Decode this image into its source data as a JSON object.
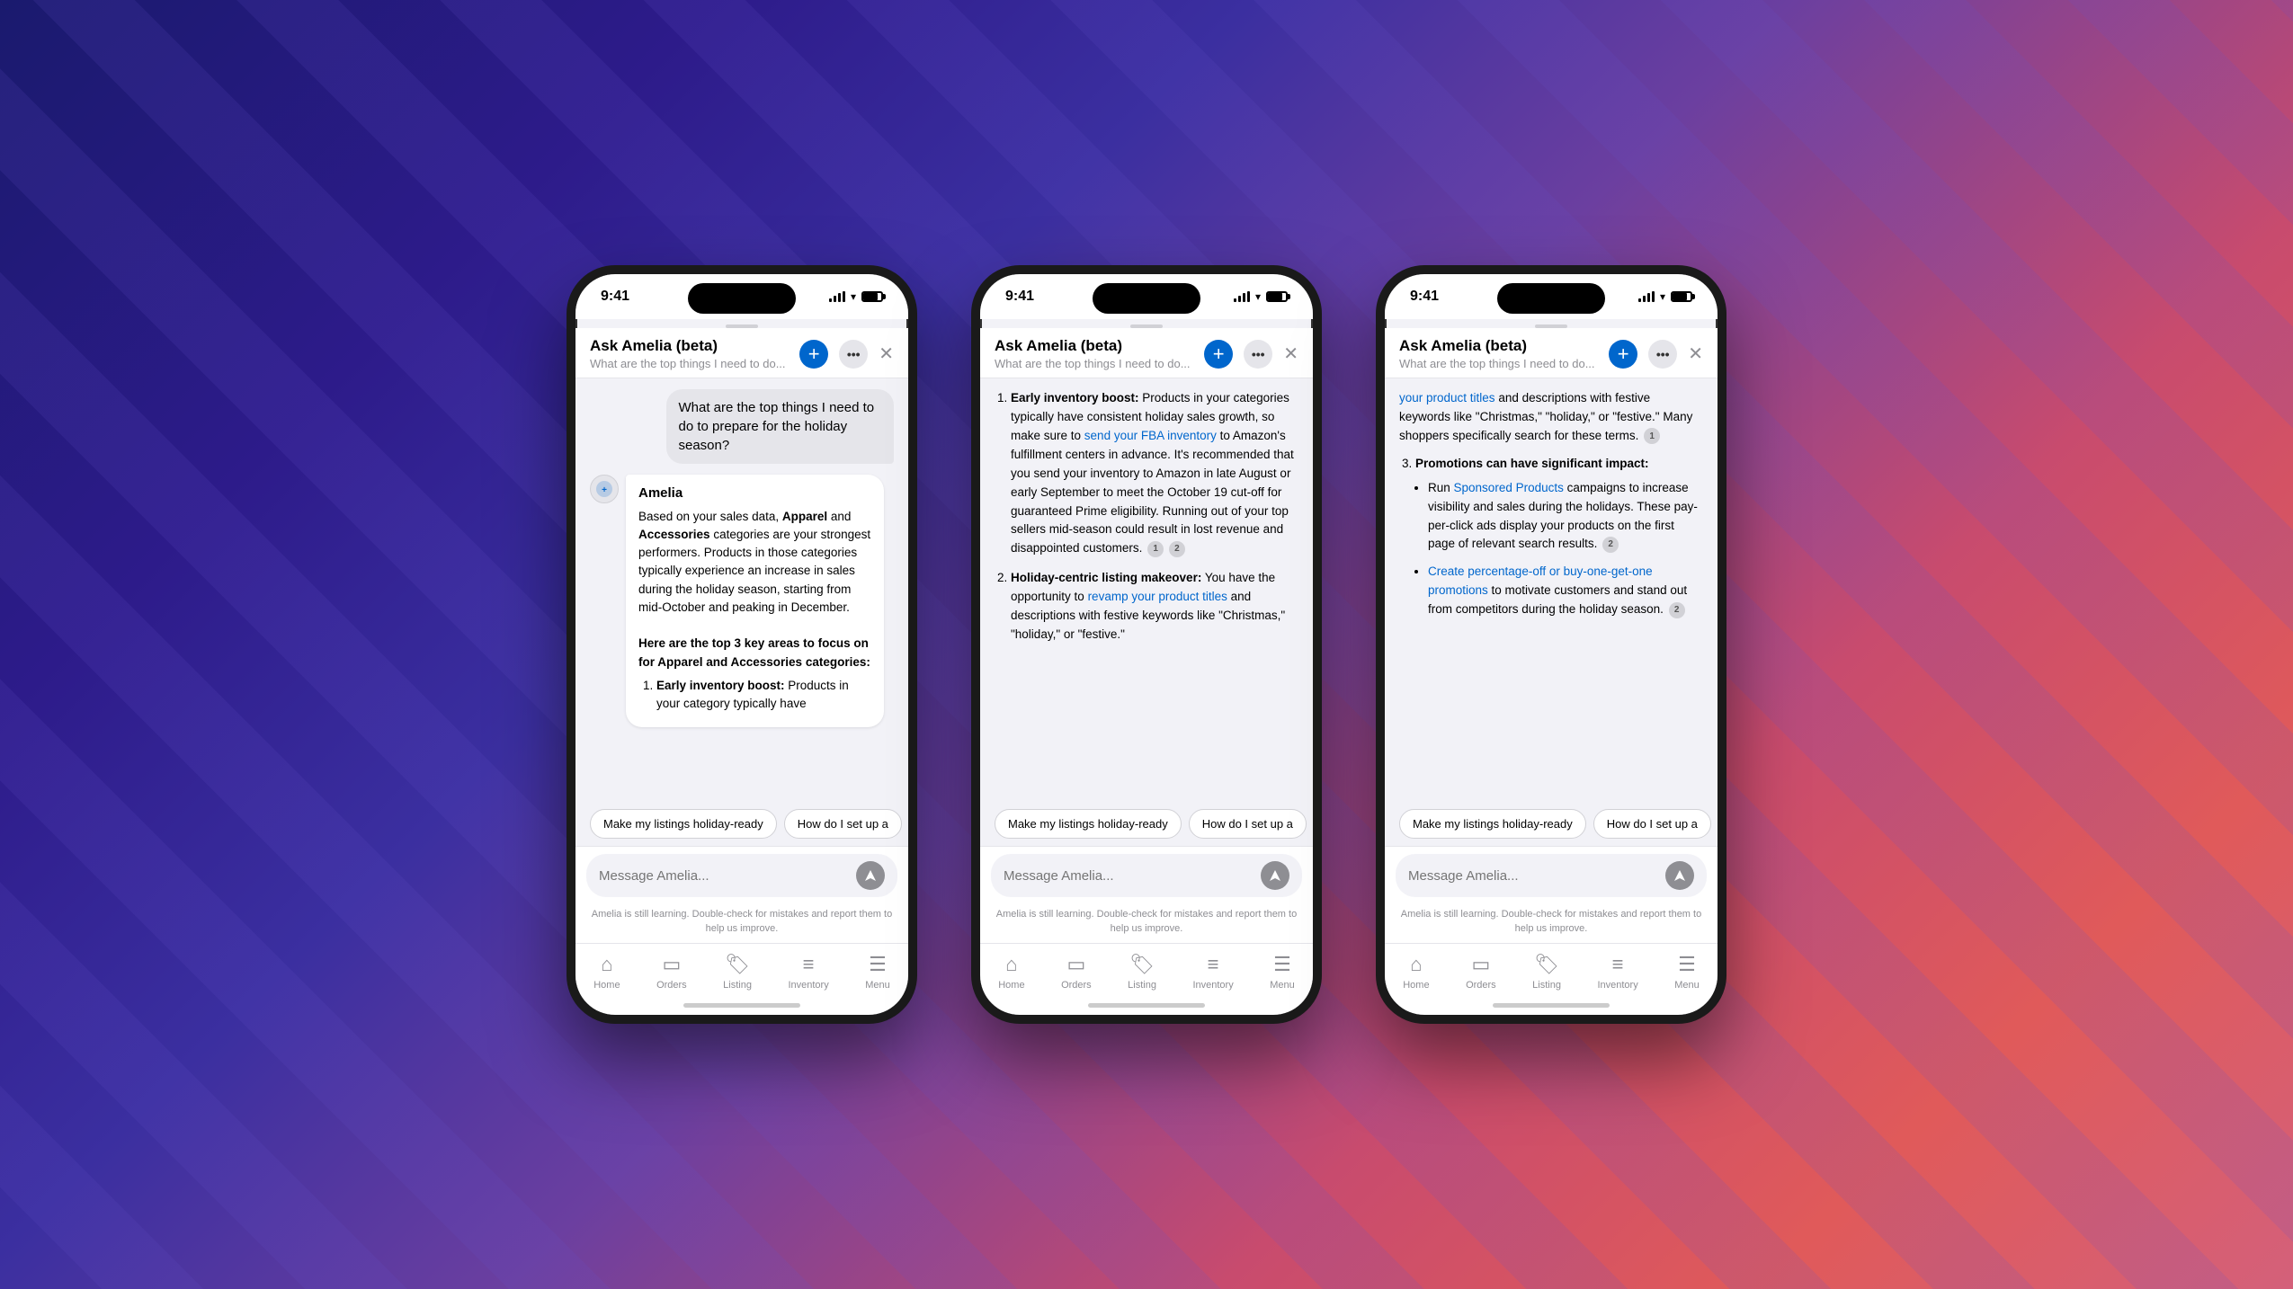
{
  "background": {
    "gradient": "dark blue to purple to pink"
  },
  "phones": [
    {
      "id": "phone1",
      "statusBar": {
        "time": "9:41",
        "signal": true,
        "wifi": true,
        "battery": true
      },
      "header": {
        "title": "Ask Amelia (beta)",
        "subtitle": "What are the top things I need to do...",
        "addBtn": "+",
        "moreBtn": "···",
        "closeBtn": "✕"
      },
      "userMessage": "What are the top things I need to do to prepare for the holiday season?",
      "ameliaName": "Amelia",
      "ameliaResponse": "Based on your sales data, Apparel and Accessories categories are your strongest performers. Products in those categories typically experience an increase in sales during the holiday season, starting from mid-October and peaking in December.\n\nHere are the top 3 key areas to focus on for Apparel and Accessories categories:\n\n1. Early inventory boost: Products in your category typically have",
      "quickReplies": [
        "Make my listings holiday-ready",
        "How do I set up a"
      ],
      "inputPlaceholder": "Message Amelia...",
      "disclaimer": "Amelia is still learning. Double-check for mistakes and report them to help us improve.",
      "navItems": [
        {
          "icon": "🏠",
          "label": "Home"
        },
        {
          "icon": "📦",
          "label": "Orders"
        },
        {
          "icon": "🏷️",
          "label": "Listing"
        },
        {
          "icon": "📋",
          "label": "Inventory"
        },
        {
          "icon": "☰",
          "label": "Menu"
        }
      ]
    },
    {
      "id": "phone2",
      "statusBar": {
        "time": "9:41"
      },
      "header": {
        "title": "Ask Amelia (beta)",
        "subtitle": "What are the top things I need to do...",
        "addBtn": "+",
        "moreBtn": "···",
        "closeBtn": "✕"
      },
      "content": {
        "items": [
          {
            "num": "1",
            "title": "Early inventory boost:",
            "text": " Products in your categories typically have consistent holiday sales growth, so make sure to ",
            "link1": "send your FBA inventory",
            "text2": " to Amazon's fulfillment centers in advance. It's recommended that you send your inventory to Amazon in late August or early September to meet the October 19 cut-off for guaranteed Prime eligibility. Running out of your top sellers mid-season could result in lost revenue and disappointed customers.",
            "citations": [
              "1",
              "2"
            ]
          },
          {
            "num": "2",
            "title": "Holiday-centric listing makeover:",
            "text": " You have the opportunity to ",
            "link1": "revamp your product titles",
            "text2": " and descriptions with festive keywords like \"Christmas,\" \"holiday,\" or \"festive.\""
          }
        ]
      },
      "quickReplies": [
        "Make my listings holiday-ready",
        "How do I set up a"
      ],
      "inputPlaceholder": "Message Amelia...",
      "disclaimer": "Amelia is still learning. Double-check for mistakes and report them to help us improve.",
      "navItems": [
        {
          "icon": "🏠",
          "label": "Home"
        },
        {
          "icon": "📦",
          "label": "Orders"
        },
        {
          "icon": "🏷️",
          "label": "Listing"
        },
        {
          "icon": "📋",
          "label": "Inventory"
        },
        {
          "icon": "☰",
          "label": "Menu"
        }
      ]
    },
    {
      "id": "phone3",
      "statusBar": {
        "time": "9:41"
      },
      "header": {
        "title": "Ask Amelia (beta)",
        "subtitle": "What are the top things I need to do...",
        "addBtn": "+",
        "moreBtn": "···",
        "closeBtn": "✕"
      },
      "content": {
        "intro": {
          "link": "your product titles",
          "text": " and descriptions with festive keywords like \"Christmas,\" \"holiday,\" or \"festive.\" Many shoppers specifically search for these terms.",
          "citation": "1"
        },
        "item3": {
          "num": "3",
          "title": "Promotions can have significant impact:",
          "bullets": [
            {
              "link": "Sponsored Products",
              "text": " campaigns to increase visibility and sales during the holidays. These pay-per-click ads display your products on the first page of relevant search results.",
              "citation": "2",
              "prefix": "Run "
            },
            {
              "link": "Create percentage-off or buy-one-get-one promotions",
              "text": " to motivate customers and stand out from competitors during the holiday season.",
              "citation": "2"
            }
          ]
        }
      },
      "quickReplies": [
        "Make my listings holiday-ready",
        "How do I set up a"
      ],
      "inputPlaceholder": "Message Amelia...",
      "disclaimer": "Amelia is still learning. Double-check for mistakes and report them to help us improve.",
      "navItems": [
        {
          "icon": "🏠",
          "label": "Home"
        },
        {
          "icon": "📦",
          "label": "Orders"
        },
        {
          "icon": "🏷️",
          "label": "Listing"
        },
        {
          "icon": "📋",
          "label": "Inventory"
        },
        {
          "icon": "☰",
          "label": "Menu"
        }
      ]
    }
  ]
}
